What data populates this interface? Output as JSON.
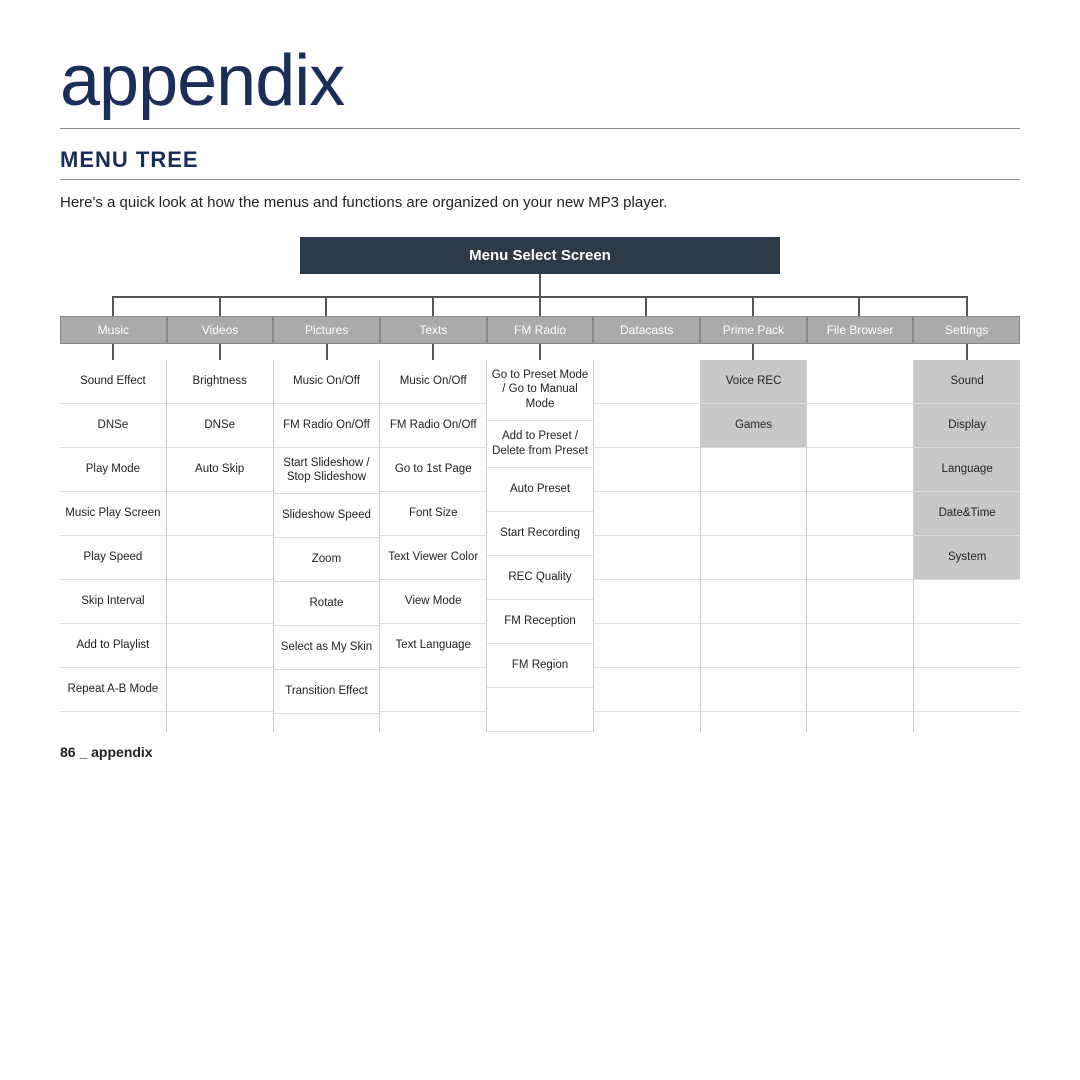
{
  "page": {
    "title": "appendix",
    "section": "MENU TREE",
    "intro": "Here's a quick look at how the menus and functions are organized on your new MP3 player.",
    "root_label": "Menu Select Screen",
    "footer": "86 _ appendix"
  },
  "columns": [
    {
      "header": "Music",
      "has_connector": true,
      "cells": [
        "Sound Effect",
        "DNSe",
        "Play Mode",
        "Music Play Screen",
        "Play Speed",
        "Skip Interval",
        "Add to Playlist",
        "Repeat A-B Mode"
      ]
    },
    {
      "header": "Videos",
      "has_connector": true,
      "cells": [
        "Brightness",
        "DNSe",
        "Auto Skip",
        "",
        "",
        "",
        "",
        ""
      ]
    },
    {
      "header": "Pictures",
      "has_connector": true,
      "cells": [
        "Music On/Off",
        "FM Radio On/Off",
        "Start Slideshow / Stop Slideshow",
        "Slideshow Speed",
        "Zoom",
        "Rotate",
        "Select as My Skin",
        "Transition Effect"
      ]
    },
    {
      "header": "Texts",
      "has_connector": true,
      "cells": [
        "Music On/Off",
        "FM Radio On/Off",
        "Go to 1st Page",
        "Font Size",
        "Text Viewer Color",
        "View Mode",
        "Text Language",
        ""
      ]
    },
    {
      "header": "FM Radio",
      "has_connector": true,
      "cells": [
        "Go to Preset Mode / Go to Manual Mode",
        "Add to Preset / Delete from Preset",
        "Auto Preset",
        "Start Recording",
        "REC Quality",
        "FM Reception",
        "FM Region",
        ""
      ]
    },
    {
      "header": "Datacasts",
      "has_connector": false,
      "cells": [
        "",
        "",
        "",
        "",
        "",
        "",
        "",
        ""
      ]
    },
    {
      "header": "Prime Pack",
      "has_connector": true,
      "cells": [
        "Voice REC",
        "Games",
        "",
        "",
        "",
        "",
        "",
        ""
      ]
    },
    {
      "header": "File Browser",
      "has_connector": false,
      "cells": [
        "",
        "",
        "",
        "",
        "",
        "",
        "",
        ""
      ]
    },
    {
      "header": "Settings",
      "has_connector": true,
      "cells": [
        "Sound",
        "Display",
        "Language",
        "Date&Time",
        "System",
        "",
        "",
        ""
      ]
    }
  ]
}
